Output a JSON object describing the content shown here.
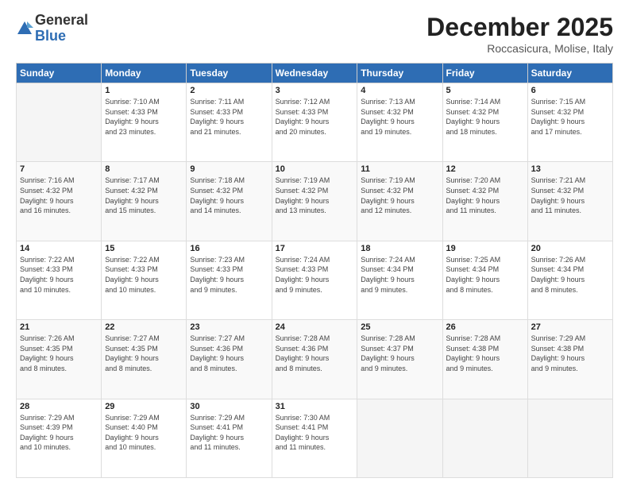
{
  "logo": {
    "general": "General",
    "blue": "Blue"
  },
  "header": {
    "month": "December 2025",
    "location": "Roccasicura, Molise, Italy"
  },
  "days_of_week": [
    "Sunday",
    "Monday",
    "Tuesday",
    "Wednesday",
    "Thursday",
    "Friday",
    "Saturday"
  ],
  "weeks": [
    [
      {
        "day": "",
        "info": ""
      },
      {
        "day": "1",
        "info": "Sunrise: 7:10 AM\nSunset: 4:33 PM\nDaylight: 9 hours\nand 23 minutes."
      },
      {
        "day": "2",
        "info": "Sunrise: 7:11 AM\nSunset: 4:33 PM\nDaylight: 9 hours\nand 21 minutes."
      },
      {
        "day": "3",
        "info": "Sunrise: 7:12 AM\nSunset: 4:33 PM\nDaylight: 9 hours\nand 20 minutes."
      },
      {
        "day": "4",
        "info": "Sunrise: 7:13 AM\nSunset: 4:32 PM\nDaylight: 9 hours\nand 19 minutes."
      },
      {
        "day": "5",
        "info": "Sunrise: 7:14 AM\nSunset: 4:32 PM\nDaylight: 9 hours\nand 18 minutes."
      },
      {
        "day": "6",
        "info": "Sunrise: 7:15 AM\nSunset: 4:32 PM\nDaylight: 9 hours\nand 17 minutes."
      }
    ],
    [
      {
        "day": "7",
        "info": "Sunrise: 7:16 AM\nSunset: 4:32 PM\nDaylight: 9 hours\nand 16 minutes."
      },
      {
        "day": "8",
        "info": "Sunrise: 7:17 AM\nSunset: 4:32 PM\nDaylight: 9 hours\nand 15 minutes."
      },
      {
        "day": "9",
        "info": "Sunrise: 7:18 AM\nSunset: 4:32 PM\nDaylight: 9 hours\nand 14 minutes."
      },
      {
        "day": "10",
        "info": "Sunrise: 7:19 AM\nSunset: 4:32 PM\nDaylight: 9 hours\nand 13 minutes."
      },
      {
        "day": "11",
        "info": "Sunrise: 7:19 AM\nSunset: 4:32 PM\nDaylight: 9 hours\nand 12 minutes."
      },
      {
        "day": "12",
        "info": "Sunrise: 7:20 AM\nSunset: 4:32 PM\nDaylight: 9 hours\nand 11 minutes."
      },
      {
        "day": "13",
        "info": "Sunrise: 7:21 AM\nSunset: 4:32 PM\nDaylight: 9 hours\nand 11 minutes."
      }
    ],
    [
      {
        "day": "14",
        "info": "Sunrise: 7:22 AM\nSunset: 4:33 PM\nDaylight: 9 hours\nand 10 minutes."
      },
      {
        "day": "15",
        "info": "Sunrise: 7:22 AM\nSunset: 4:33 PM\nDaylight: 9 hours\nand 10 minutes."
      },
      {
        "day": "16",
        "info": "Sunrise: 7:23 AM\nSunset: 4:33 PM\nDaylight: 9 hours\nand 9 minutes."
      },
      {
        "day": "17",
        "info": "Sunrise: 7:24 AM\nSunset: 4:33 PM\nDaylight: 9 hours\nand 9 minutes."
      },
      {
        "day": "18",
        "info": "Sunrise: 7:24 AM\nSunset: 4:34 PM\nDaylight: 9 hours\nand 9 minutes."
      },
      {
        "day": "19",
        "info": "Sunrise: 7:25 AM\nSunset: 4:34 PM\nDaylight: 9 hours\nand 8 minutes."
      },
      {
        "day": "20",
        "info": "Sunrise: 7:26 AM\nSunset: 4:34 PM\nDaylight: 9 hours\nand 8 minutes."
      }
    ],
    [
      {
        "day": "21",
        "info": "Sunrise: 7:26 AM\nSunset: 4:35 PM\nDaylight: 9 hours\nand 8 minutes."
      },
      {
        "day": "22",
        "info": "Sunrise: 7:27 AM\nSunset: 4:35 PM\nDaylight: 9 hours\nand 8 minutes."
      },
      {
        "day": "23",
        "info": "Sunrise: 7:27 AM\nSunset: 4:36 PM\nDaylight: 9 hours\nand 8 minutes."
      },
      {
        "day": "24",
        "info": "Sunrise: 7:28 AM\nSunset: 4:36 PM\nDaylight: 9 hours\nand 8 minutes."
      },
      {
        "day": "25",
        "info": "Sunrise: 7:28 AM\nSunset: 4:37 PM\nDaylight: 9 hours\nand 9 minutes."
      },
      {
        "day": "26",
        "info": "Sunrise: 7:28 AM\nSunset: 4:38 PM\nDaylight: 9 hours\nand 9 minutes."
      },
      {
        "day": "27",
        "info": "Sunrise: 7:29 AM\nSunset: 4:38 PM\nDaylight: 9 hours\nand 9 minutes."
      }
    ],
    [
      {
        "day": "28",
        "info": "Sunrise: 7:29 AM\nSunset: 4:39 PM\nDaylight: 9 hours\nand 10 minutes."
      },
      {
        "day": "29",
        "info": "Sunrise: 7:29 AM\nSunset: 4:40 PM\nDaylight: 9 hours\nand 10 minutes."
      },
      {
        "day": "30",
        "info": "Sunrise: 7:29 AM\nSunset: 4:41 PM\nDaylight: 9 hours\nand 11 minutes."
      },
      {
        "day": "31",
        "info": "Sunrise: 7:30 AM\nSunset: 4:41 PM\nDaylight: 9 hours\nand 11 minutes."
      },
      {
        "day": "",
        "info": ""
      },
      {
        "day": "",
        "info": ""
      },
      {
        "day": "",
        "info": ""
      }
    ]
  ]
}
